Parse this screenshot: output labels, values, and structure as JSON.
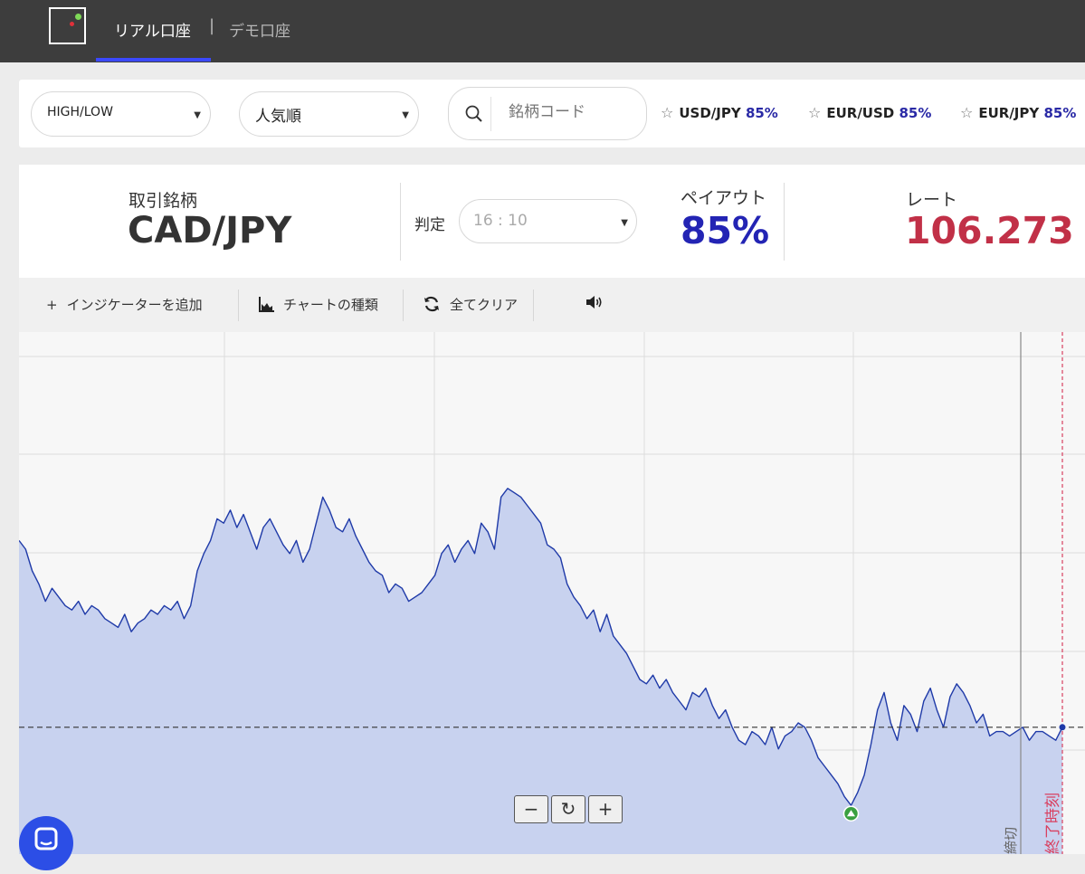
{
  "nav": {
    "tab_real": "リアル口座",
    "separator": "|",
    "tab_demo": "デモ口座"
  },
  "filters": {
    "type_select": "HIGH/LOW",
    "sort_select": "人気順",
    "search_placeholder": "銘柄コード",
    "favorites": [
      {
        "pair": "USD/JPY",
        "payout": "85%"
      },
      {
        "pair": "EUR/USD",
        "payout": "85%"
      },
      {
        "pair": "EUR/JPY",
        "payout": "85%"
      }
    ]
  },
  "info": {
    "symbol_label": "取引銘柄",
    "symbol": "CAD/JPY",
    "judge_label": "判定",
    "judge_time": "16 : 10",
    "payout_label": "ペイアウト",
    "payout": "85%",
    "rate_label": "レート",
    "rate": "106.273"
  },
  "toolbar": {
    "add_indicator": "インジケーターを追加",
    "chart_type": "チャートの種類",
    "clear_all": "全てクリア"
  },
  "chart": {
    "deadline_label": "締切",
    "end_time_label": "終了時刻",
    "zoom_out": "−",
    "reset": "↻",
    "zoom_in": "+",
    "colors": {
      "line": "#1f3aa8",
      "fill": "#c8d2ef",
      "end_marker": "#d94060",
      "low_marker": "#3aa040"
    },
    "chart_data": {
      "type": "area",
      "values": [
        62,
        60,
        55,
        52,
        48,
        51,
        49,
        47,
        46,
        48,
        45,
        47,
        46,
        44,
        43,
        42,
        45,
        41,
        43,
        44,
        46,
        45,
        47,
        46,
        48,
        44,
        47,
        55,
        59,
        62,
        67,
        66,
        69,
        65,
        68,
        64,
        60,
        65,
        67,
        64,
        61,
        59,
        62,
        57,
        60,
        66,
        72,
        69,
        65,
        64,
        67,
        63,
        60,
        57,
        55,
        54,
        50,
        52,
        51,
        48,
        49,
        50,
        52,
        54,
        59,
        61,
        57,
        60,
        62,
        59,
        66,
        64,
        60,
        72,
        74,
        73,
        72,
        70,
        68,
        66,
        61,
        60,
        58,
        52,
        49,
        47,
        44,
        46,
        41,
        45,
        40,
        38,
        36,
        33,
        30,
        29,
        31,
        28,
        30,
        27,
        25,
        23,
        27,
        26,
        28,
        24,
        21,
        23,
        19,
        16,
        15,
        18,
        17,
        15,
        19,
        14,
        17,
        18,
        20,
        19,
        16,
        12,
        10,
        8,
        6,
        3,
        1,
        4,
        8,
        15,
        23,
        27,
        20,
        16,
        24,
        22,
        18,
        25,
        28,
        23,
        19,
        26,
        29,
        27,
        24,
        20,
        22,
        17,
        18,
        18,
        17,
        18,
        19,
        16,
        18,
        18,
        17,
        16,
        19
      ]
    }
  }
}
